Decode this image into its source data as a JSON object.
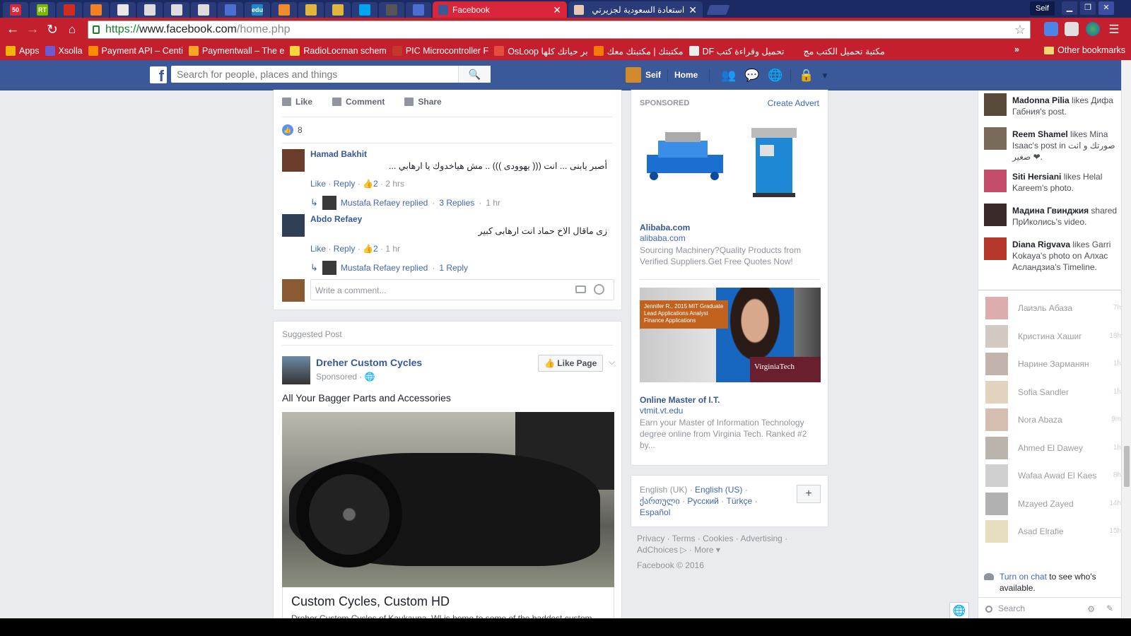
{
  "browser": {
    "tabs": [
      {
        "label": "50",
        "color": "#d9263a"
      },
      {
        "label": "RT",
        "color": "#7ab800"
      },
      {
        "label": "",
        "color": "#d52b1e"
      },
      {
        "label": "",
        "color": "#f48024"
      },
      {
        "label": "",
        "color": "#e8e8e8"
      },
      {
        "label": "",
        "color": "#dddddd"
      },
      {
        "label": "",
        "color": "#dddddd"
      },
      {
        "label": "",
        "color": "#dddddd"
      },
      {
        "label": "",
        "color": "#4a6fd1"
      },
      {
        "label": "edu",
        "color": "#1e88c9"
      },
      {
        "label": "",
        "color": "#f28c28"
      },
      {
        "label": "",
        "color": "#e2b53b"
      },
      {
        "label": "",
        "color": "#e2b53b"
      },
      {
        "label": "",
        "color": "#00a4ef"
      },
      {
        "label": "",
        "color": "#555555"
      },
      {
        "label": "",
        "color": "#4a6fd1"
      }
    ],
    "active_tab": {
      "title": "Facebook",
      "close": "✕"
    },
    "second_tab": {
      "title": "استعادة السعودية لجزيرتي",
      "close": "✕"
    },
    "window_user": "Seif",
    "window_buttons": [
      "▁",
      "❐",
      "✕"
    ],
    "url": {
      "scheme": "https://",
      "host": "www.facebook.com",
      "path": "/home.php"
    },
    "bookmarks": [
      {
        "label": "Apps",
        "color": "#f4b400"
      },
      {
        "label": "Xsolla",
        "color": "#6b5bd6"
      },
      {
        "label": "Payment API – Centi",
        "color": "#ff8c00"
      },
      {
        "label": "Paymentwall – The e",
        "color": "#f5a623"
      },
      {
        "label": "RadioLocman schem",
        "color": "#f7d63c"
      },
      {
        "label": "PIC Microcontroller F",
        "color": "#c0392b"
      },
      {
        "label": "OsLoop بر حياتك كلها",
        "color": "#e74c3c"
      },
      {
        "label": "مكتبتك | مكتبتك معك",
        "color": "#f57c00"
      },
      {
        "label": "DF تحميل وقراءة كتب",
        "color": "#eeeeee"
      },
      {
        "label": "مكتبة تحميل الكتب مج",
        "color": "#c31f2c"
      }
    ],
    "bookmarks_more": "»",
    "other_bookmarks": "Other bookmarks"
  },
  "fb_header": {
    "logo": "f",
    "search_placeholder": "Search for people, places and things",
    "user_name": "Seif",
    "home_label": "Home"
  },
  "post1": {
    "actions": {
      "like": "Like",
      "comment": "Comment",
      "share": "Share"
    },
    "like_count": "8",
    "comments": [
      {
        "author": "Hamad Bakhit",
        "text": "أصبر يابنى ... انت ((( يهوودى ))) .. مش هياخدوك يا ارهابي ...",
        "like": "Like",
        "reply": "Reply",
        "likes": "2",
        "time": "2 hrs",
        "replies": {
          "who": "Mustafa Refaey replied",
          "count": "3 Replies",
          "time": "1 hr"
        }
      },
      {
        "author": "Abdo Refaey",
        "text": "زى ماقال الاخ حماد انت ارهابى كبير",
        "like": "Like",
        "reply": "Reply",
        "likes": "2",
        "time": "1 hr",
        "replies": {
          "who": "Mustafa Refaey replied",
          "count": "1 Reply",
          "time": ""
        }
      }
    ],
    "composer_placeholder": "Write a comment..."
  },
  "post2": {
    "label": "Suggested Post",
    "page_name": "Dreher Custom Cycles",
    "sponsored": "Sponsored · 🌐",
    "like_page": "👍 Like Page",
    "chevron": "⌵",
    "text": "All Your Bagger Parts and Accessories",
    "caption_title": "Custom Cycles, Custom HD",
    "caption_desc": "Dreher Custom Cycles of Kaukauna, WI is home to some of the baddest custom"
  },
  "ads": {
    "header": "SPONSORED",
    "create": "Create Advert",
    "ad1": {
      "title": "Alibaba.com",
      "domain": "alibaba.com",
      "desc": "Sourcing Machinery?Quality Products from Verified Suppliers.Get Free Quotes Now!"
    },
    "ad2": {
      "banner_text": "Jennifer R., 2015 MIT Graduate Lead Applications Analyst Finance Applications",
      "brand": "VirginiaTech",
      "title": "Online Master of I.T.",
      "domain": "vtmit.vt.edu",
      "desc": "Earn your Master of Information Technology degree online from Virginia Tech. Ranked #2 by..."
    }
  },
  "languages": {
    "current": "English (UK) · ",
    "links": [
      "English (US)",
      "ქართული",
      "Русский",
      "Türkçe",
      "Español"
    ],
    "plus": "+"
  },
  "footer": {
    "links": "Privacy · Terms · Cookies · Advertising · AdChoices ▷ · More ▾",
    "copyright": "Facebook © 2016"
  },
  "ticker": [
    {
      "name": "Madonna Pilia",
      "rest": " likes Дифа Габния's post.",
      "color": "#5a4a3a"
    },
    {
      "name": "Reem Shamel",
      "rest": " likes Mina Isaac's post in صورتك و انت صغير ❤.",
      "color": "#7a6a5a"
    },
    {
      "name": "Siti Hersiani",
      "rest": " likes Helal Kareem's photo.",
      "color": "#c44d6a"
    },
    {
      "name": "Мадина Гвинджия",
      "rest": " shared ПрИколись's video.",
      "color": "#3a2a2a"
    },
    {
      "name": "Diana Rigvava",
      "rest": " likes Garri Kokaya's photo on Алхас Асландзиа's Timeline.",
      "color": "#b5382a"
    }
  ],
  "buddies": [
    {
      "name": "Лаиэль Абаза",
      "time": "7h",
      "color": "#b44a4a"
    },
    {
      "name": "Кристина Хашиг",
      "time": "18h",
      "color": "#9c8a7a"
    },
    {
      "name": "Нарине Зарманян",
      "time": "1h",
      "color": "#7a5a4a"
    },
    {
      "name": "Sofia Sandler",
      "time": "1h",
      "color": "#c0a070"
    },
    {
      "name": "Nora Abaza",
      "time": "9m",
      "color": "#a07050"
    },
    {
      "name": "Ahmed El Dawey",
      "time": "1h",
      "color": "#6a5a4a"
    },
    {
      "name": "Wafaa Awad El Kaes",
      "time": "8h",
      "color": "#999999"
    },
    {
      "name": "Mzayed Zayed",
      "time": "14h",
      "color": "#555555"
    },
    {
      "name": "Asad Elrafie",
      "time": "15h",
      "color": "#c8b870"
    }
  ],
  "chat": {
    "turn_on": "Turn on chat",
    "rest": " to see who's available.",
    "search": "Search"
  }
}
